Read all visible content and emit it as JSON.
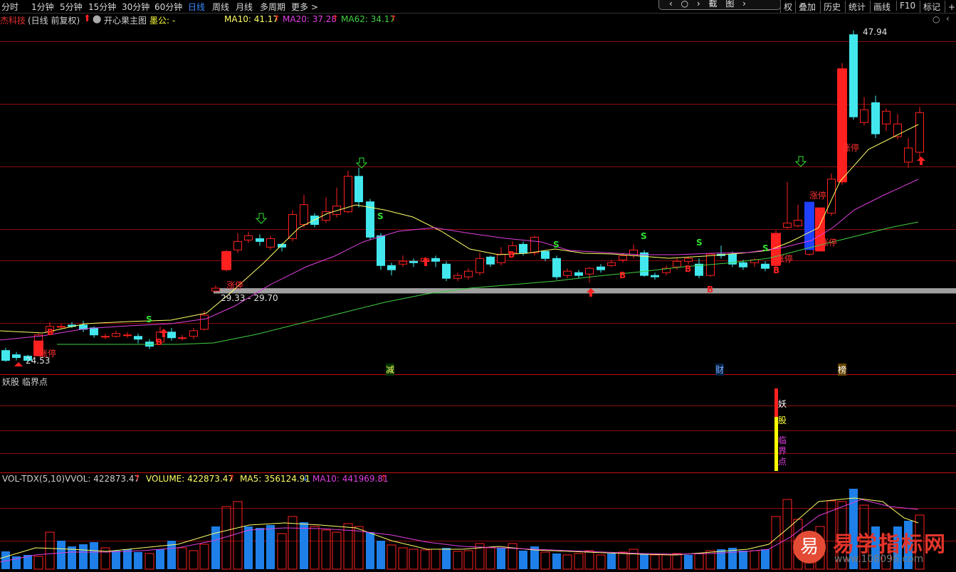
{
  "toolbar": {
    "tabs": [
      "分时",
      "1分钟",
      "5分钟",
      "15分钟",
      "30分钟",
      "60分钟",
      "日线",
      "周线",
      "月线",
      "多周期",
      "更多 >"
    ],
    "active_tab": "日线",
    "center_glyphs": "‹ ○ › 截 图 ›",
    "right_tabs": [
      "权",
      "叠加",
      "历史",
      "统计",
      "画线",
      "F10",
      "标记",
      "+自"
    ]
  },
  "main_panel": {
    "stock_label": "杰科技",
    "period_label": "(日线 前复权)",
    "template_label": "开心果主图",
    "indicator_label": "墨公: -",
    "ma10_label": "MA10: 41.17",
    "ma20_label": "MA20: 37.28",
    "ma62_label": "MA62: 34.17",
    "high_price_label": "47.94",
    "low_price_label": "24.53",
    "support_band_label": "29.33 - 29.70",
    "event_labels": [
      "减",
      "财",
      "榜"
    ],
    "limit_up_label": "涨停",
    "signals": {
      "buy": "B",
      "sell": "S"
    }
  },
  "sub_panel": {
    "title": "妖股 临界点",
    "signal_chars": [
      "妖",
      "股",
      "临",
      "界",
      "点"
    ]
  },
  "volume_panel": {
    "indicator_name": "VOL-TDX(5,10)",
    "vvol_label": "VVOL: 422873.47",
    "volume_label": "VOLUME: 422873.47",
    "ma5_label": "MA5: 356124.91",
    "ma10_label": "MA10: 441969.81"
  },
  "watermark": {
    "logo_char": "易",
    "site_name": "易学指标网",
    "url": "www.108096.com"
  },
  "colors": {
    "up": "#ff2020",
    "down": "#42e8ee",
    "ma10": "#ffff66",
    "ma20": "#e040e0",
    "ma62": "#40d040",
    "volume_down": "#1e7fe8"
  }
}
